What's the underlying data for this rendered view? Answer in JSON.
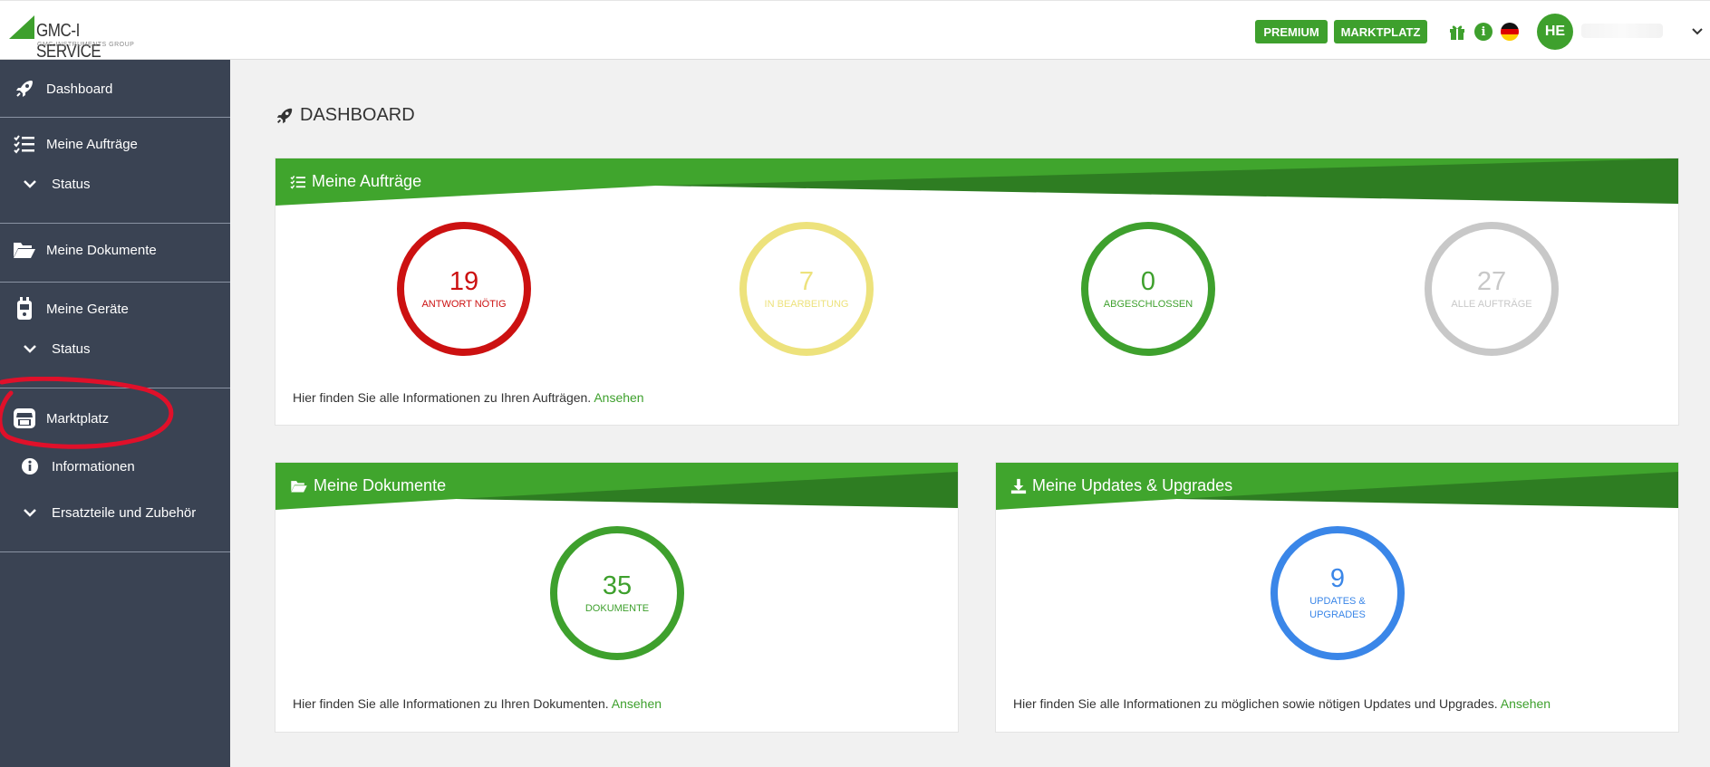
{
  "brand": {
    "name": "GMC-I SERVICE",
    "subtitle": "GMC-INSTRUMENTS GROUP"
  },
  "topbar": {
    "premium_label": "PREMIUM",
    "marktplatz_label": "MARKTPLATZ",
    "info_glyph": "i",
    "avatar_initials": "HE",
    "icons": [
      "gift-icon",
      "info-icon",
      "german-flag-icon",
      "chevron-down-icon"
    ]
  },
  "sidebar": {
    "dashboard": "Dashboard",
    "auftraege": "Meine Aufträge",
    "auftraege_status": "Status",
    "dokumente": "Meine Dokumente",
    "geraete": "Meine Geräte",
    "geraete_status": "Status",
    "marktplatz": "Marktplatz",
    "informationen": "Informationen",
    "ersatzteile": "Ersatzteile und Zubehör"
  },
  "page": {
    "title": "DASHBOARD"
  },
  "auftraege_card": {
    "title": "Meine Aufträge",
    "stats": [
      {
        "value": "19",
        "caption": "ANTWORT NÖTIG",
        "color": "#cc1111"
      },
      {
        "value": "7",
        "caption": "IN BEARBEITUNG",
        "color": "#ede27c"
      },
      {
        "value": "0",
        "caption": "ABGESCHLOSSEN",
        "color": "#3ea02d"
      },
      {
        "value": "27",
        "caption": "ALLE AUFTRÄGE",
        "color": "#c8c8c8"
      }
    ],
    "footer_text": "Hier finden Sie alle Informationen zu Ihren Aufträgen.",
    "footer_link": "Ansehen"
  },
  "dokumente_card": {
    "title": "Meine Dokumente",
    "value": "35",
    "caption": "DOKUMENTE",
    "color": "#3ea02d",
    "footer_text": "Hier finden Sie alle Informationen zu Ihren Dokumenten.",
    "footer_link": "Ansehen"
  },
  "updates_card": {
    "title": "Meine Updates & Upgrades",
    "value": "9",
    "caption_line1": "UPDATES &",
    "caption_line2": "UPGRADES",
    "color": "#3a86e8",
    "footer_text": "Hier finden Sie alle Informationen zu möglichen sowie nötigen Updates und Upgrades.",
    "footer_link": "Ansehen"
  },
  "colors": {
    "accent": "#3ea02d",
    "accent_dark": "#2e7d22",
    "sidebar": "#3a4353",
    "annotation": "#e0102a"
  }
}
